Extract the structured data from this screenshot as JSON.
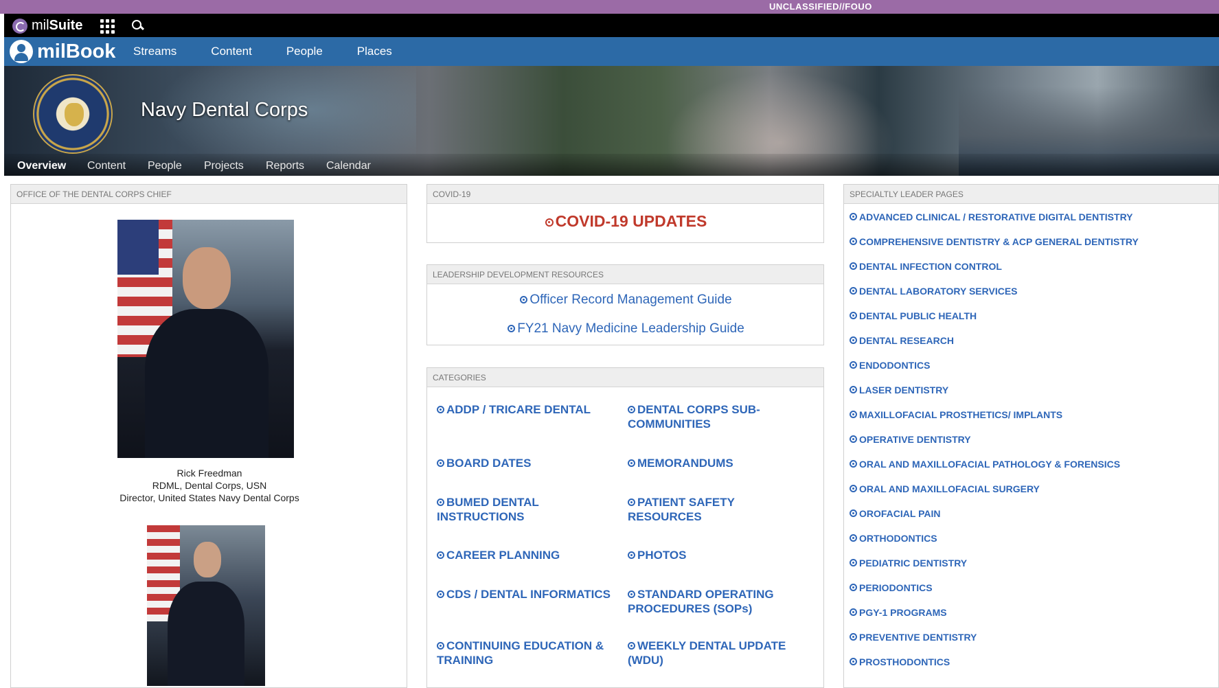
{
  "classification": "UNCLASSIFIED//FOUO",
  "topbar": {
    "brand_prefix": "mil",
    "brand_suffix": "Suite"
  },
  "navbar": {
    "brand": "milBook",
    "links": [
      "Streams",
      "Content",
      "People",
      "Places"
    ]
  },
  "banner": {
    "title": "Navy Dental Corps",
    "subnav": [
      "Overview",
      "Content",
      "People",
      "Projects",
      "Reports",
      "Calendar"
    ],
    "active_tab": "Overview"
  },
  "office_panel": {
    "header": "OFFICE OF THE DENTAL CORPS CHIEF",
    "person1": {
      "name": "Rick Freedman",
      "rank": "RDML, Dental Corps, USN",
      "title": "Director, United States Navy Dental Corps"
    }
  },
  "covid_panel": {
    "header": "COVID-19",
    "link": "COVID-19 UPDATES"
  },
  "leadership_panel": {
    "header": "LEADERSHIP DEVELOPMENT RESOURCES",
    "links": [
      "Officer Record Management Guide",
      "FY21 Navy Medicine Leadership Guide"
    ]
  },
  "categories_panel": {
    "header": "CATEGORIES",
    "left": [
      "ADDP / TRICARE DENTAL",
      "BOARD DATES",
      "BUMED DENTAL INSTRUCTIONS",
      "CAREER PLANNING",
      "CDS / DENTAL INFORMATICS",
      "CONTINUING EDUCATION & TRAINING"
    ],
    "right": [
      "DENTAL CORPS SUB-COMMUNITIES",
      "MEMORANDUMS",
      "PATIENT SAFETY RESOURCES",
      "PHOTOS",
      "STANDARD OPERATING PROCEDURES (SOPs)",
      "WEEKLY DENTAL UPDATE (WDU)"
    ]
  },
  "specialty_panel": {
    "header": "SPECIALTLY LEADER PAGES",
    "links": [
      "ADVANCED CLINICAL / RESTORATIVE DIGITAL DENTISTRY",
      "COMPREHENSIVE DENTISTRY & ACP GENERAL DENTISTRY",
      "DENTAL INFECTION CONTROL",
      "DENTAL LABORATORY SERVICES",
      "DENTAL PUBLIC HEALTH",
      "DENTAL RESEARCH",
      "ENDODONTICS",
      "LASER DENTISTRY",
      "MAXILLOFACIAL PROSTHETICS/ IMPLANTS",
      "OPERATIVE DENTISTRY",
      "ORAL AND MAXILLOFACIAL PATHOLOGY & FORENSICS",
      "ORAL AND MAXILLOFACIAL SURGERY",
      "OROFACIAL PAIN",
      "ORTHODONTICS",
      "PEDIATRIC DENTISTRY",
      "PERIODONTICS",
      "PGY-1 PROGRAMS",
      "PREVENTIVE DENTISTRY",
      "PROSTHODONTICS"
    ]
  }
}
